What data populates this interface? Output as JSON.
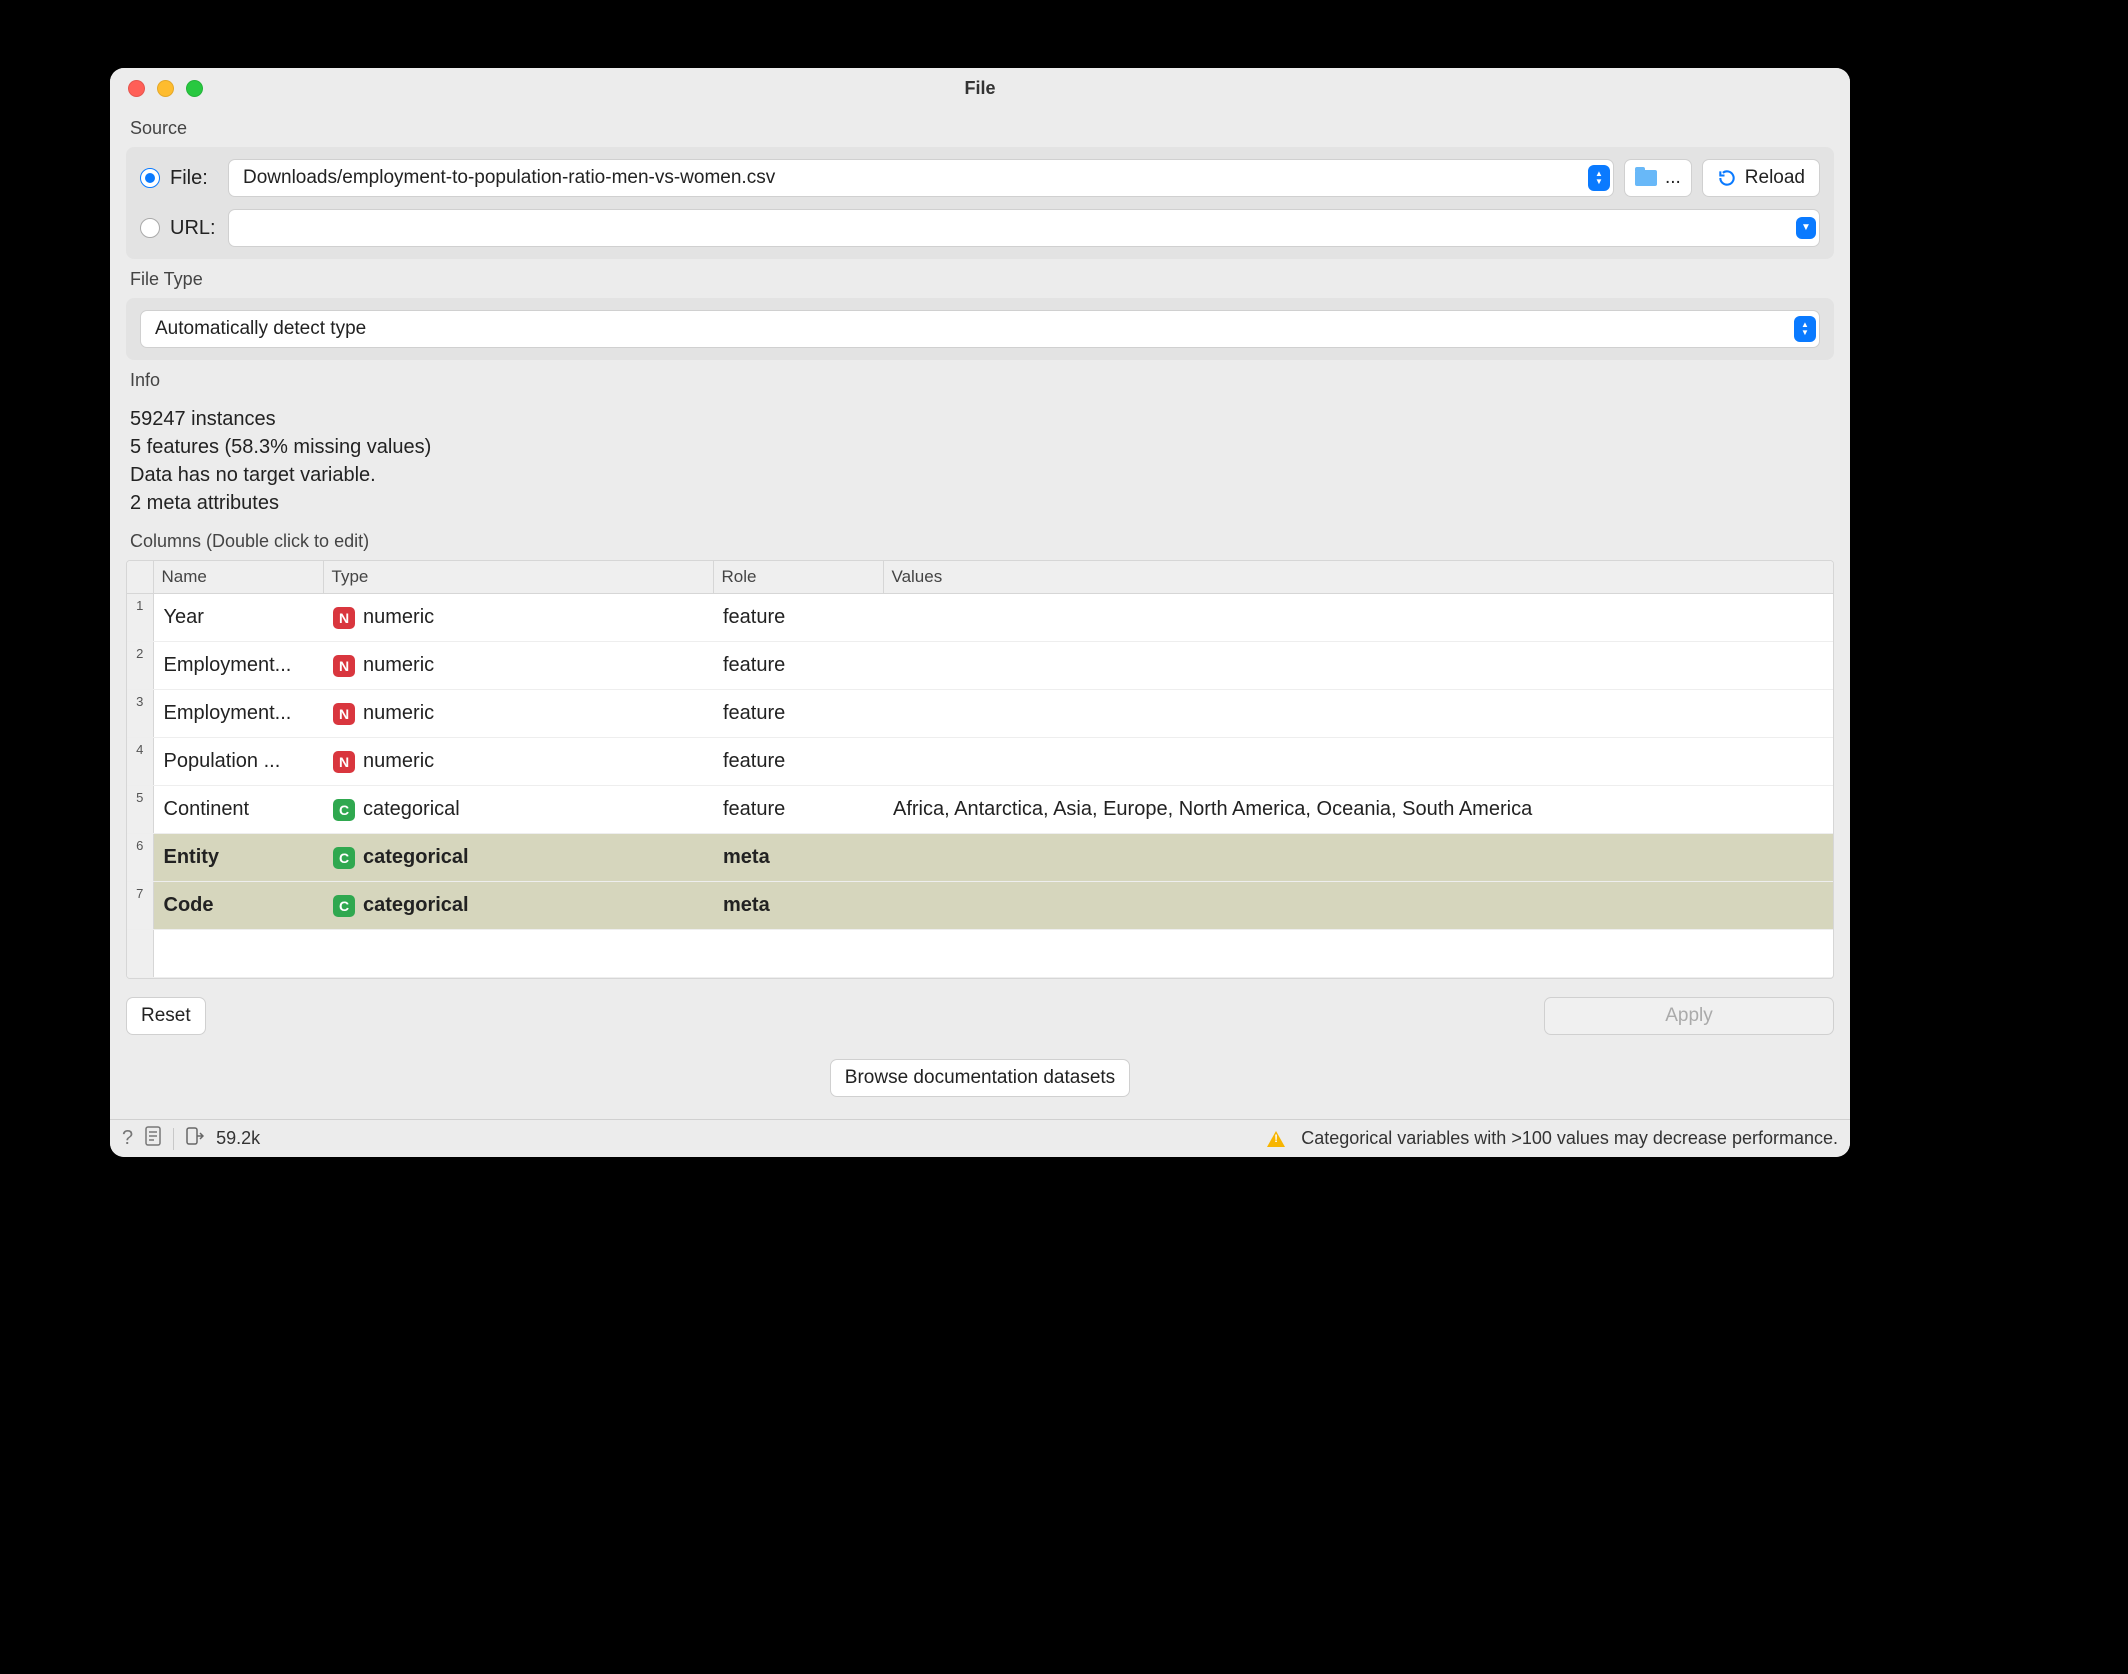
{
  "window": {
    "title": "File"
  },
  "source": {
    "label": "Source",
    "file_label": "File:",
    "url_label": "URL:",
    "file_path": "Downloads/employment-to-population-ratio-men-vs-women.csv",
    "url_value": "",
    "browse_label": "...",
    "reload_label": "Reload"
  },
  "filetype": {
    "label": "File Type",
    "value": "Automatically detect type"
  },
  "info": {
    "label": "Info",
    "line1": "59247 instances",
    "line2": "5 features (58.3% missing values)",
    "line3": "Data has no target variable.",
    "line4": "2 meta attributes"
  },
  "columns": {
    "label": "Columns (Double click to edit)",
    "headers": {
      "name": "Name",
      "type": "Type",
      "role": "Role",
      "values": "Values"
    },
    "rows": [
      {
        "n": "1",
        "name": "Year",
        "badge": "N",
        "type": "numeric",
        "role": "feature",
        "values": "",
        "meta": false
      },
      {
        "n": "2",
        "name": "Employment...",
        "badge": "N",
        "type": "numeric",
        "role": "feature",
        "values": "",
        "meta": false
      },
      {
        "n": "3",
        "name": "Employment...",
        "badge": "N",
        "type": "numeric",
        "role": "feature",
        "values": "",
        "meta": false
      },
      {
        "n": "4",
        "name": "Population ...",
        "badge": "N",
        "type": "numeric",
        "role": "feature",
        "values": "",
        "meta": false
      },
      {
        "n": "5",
        "name": "Continent",
        "badge": "C",
        "type": "categorical",
        "role": "feature",
        "values": "Africa, Antarctica, Asia, Europe, North America, Oceania, South America",
        "meta": false
      },
      {
        "n": "6",
        "name": "Entity",
        "badge": "C",
        "type": "categorical",
        "role": "meta",
        "values": "",
        "meta": true
      },
      {
        "n": "7",
        "name": "Code",
        "badge": "C",
        "type": "categorical",
        "role": "meta",
        "values": "",
        "meta": true
      }
    ]
  },
  "buttons": {
    "reset": "Reset",
    "apply": "Apply",
    "browse_docs": "Browse documentation datasets"
  },
  "status": {
    "out_count": "59.2k",
    "warning": "Categorical variables with >100 values may decrease performance."
  }
}
